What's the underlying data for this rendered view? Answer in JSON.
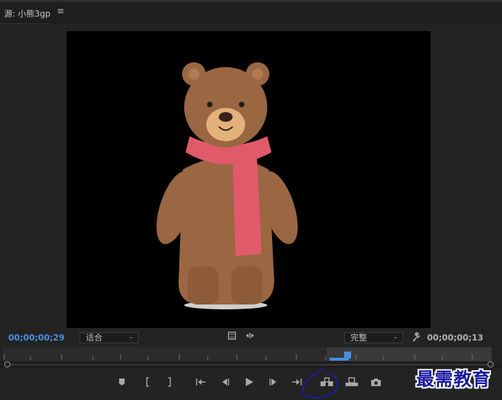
{
  "panel": {
    "title": "源: 小熊3gp",
    "menu_icon": "hamburger-icon"
  },
  "timecode": {
    "current": "00;00;00;29",
    "duration": "00;00;00;13"
  },
  "zoom": {
    "selected": "适合"
  },
  "quality": {
    "selected": "完整"
  },
  "controls": [
    {
      "name": "add-marker-button",
      "icon": "marker-icon"
    },
    {
      "name": "mark-in-button",
      "icon": "mark-in-icon"
    },
    {
      "name": "mark-out-button",
      "icon": "mark-out-icon"
    },
    {
      "name": "go-to-in-button",
      "icon": "go-to-in-icon"
    },
    {
      "name": "step-back-button",
      "icon": "step-back-icon"
    },
    {
      "name": "play-button",
      "icon": "play-icon"
    },
    {
      "name": "step-forward-button",
      "icon": "step-forward-icon"
    },
    {
      "name": "go-to-out-button",
      "icon": "go-to-out-icon"
    },
    {
      "name": "insert-button",
      "icon": "insert-icon"
    },
    {
      "name": "overwrite-button",
      "icon": "overwrite-icon"
    },
    {
      "name": "export-frame-button",
      "icon": "camera-icon"
    }
  ],
  "watermark": "最需教育",
  "colors": {
    "accent": "#4a90e2",
    "background": "#232323",
    "bear": "#9b6642",
    "scarf": "#e15a6a"
  }
}
